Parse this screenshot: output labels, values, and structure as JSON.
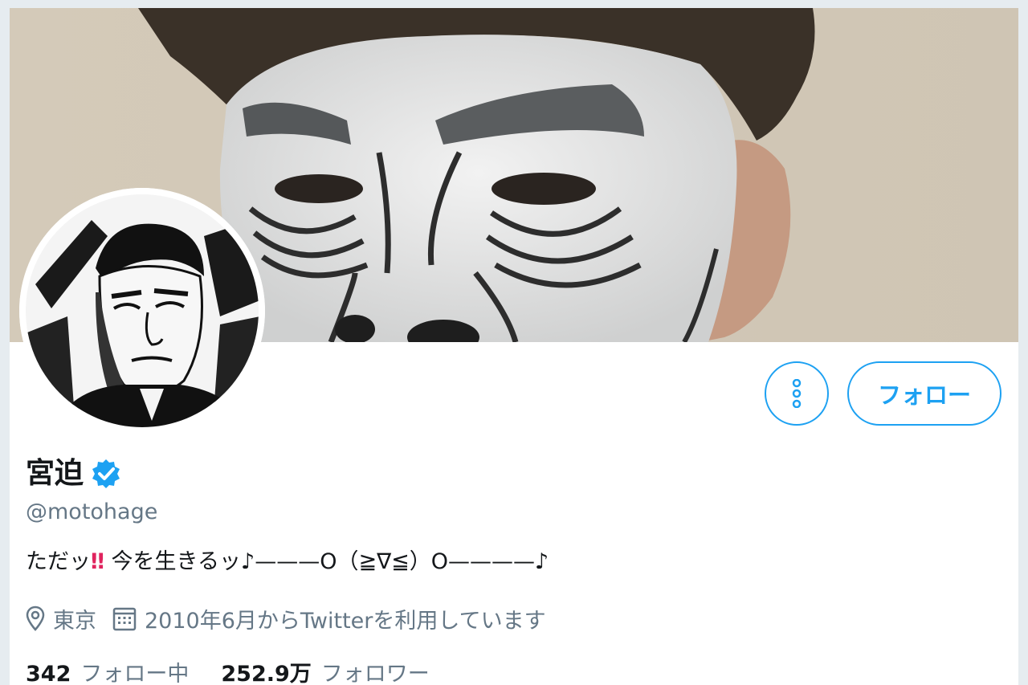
{
  "profile": {
    "display_name": "宮迫",
    "verified": true,
    "handle": "@motohage",
    "bio_prefix": "ただッ",
    "bio_emphasis": "‼",
    "bio_suffix": " 今を生きるッ♪———O（≧∇≦）O————♪",
    "location": "東京",
    "joined": "2010年6月からTwitterを利用しています"
  },
  "actions": {
    "more_icon": "more-vertical-icon",
    "follow_label": "フォロー"
  },
  "stats": {
    "following_count": "342",
    "following_label": "フォロー中",
    "followers_count": "252.9万",
    "followers_label": "フォロワー"
  },
  "icons": {
    "location": "location-pin-icon",
    "calendar": "calendar-icon",
    "verified": "verified-badge-icon"
  },
  "colors": {
    "accent": "#1da1f2",
    "text_primary": "#14171a",
    "text_secondary": "#657786",
    "emphasis": "#e0245e",
    "page_background": "#e6ecf0"
  }
}
